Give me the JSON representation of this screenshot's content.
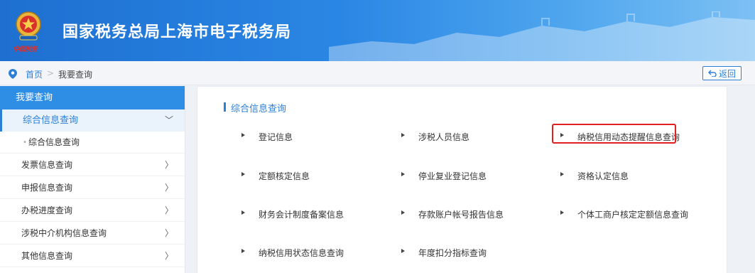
{
  "header": {
    "title": "国家税务总局上海市电子税务局",
    "emblem_icon": "tax-emblem-icon",
    "emblem_caption": "中国税务",
    "gradient_colors": [
      "#1e6fd0",
      "#7cc0f4"
    ]
  },
  "breadcrumb": {
    "home": "首页",
    "separator": ">",
    "current": "我要查询",
    "back_label": "返回",
    "pin_icon": "location-pin-icon",
    "back_icon": "return-arrow-icon"
  },
  "sidebar": {
    "heading": "我要查询",
    "active_item": {
      "label": "综合信息查询",
      "chevron": "﹀"
    },
    "sub_item": {
      "label": "综合信息查询"
    },
    "items": [
      {
        "label": "发票信息查询",
        "arrow": "〉"
      },
      {
        "label": "申报信息查询",
        "arrow": "〉"
      },
      {
        "label": "办税进度查询",
        "arrow": "〉"
      },
      {
        "label": "涉税中介机构信息查询",
        "arrow": "〉"
      },
      {
        "label": "其他信息查询",
        "arrow": "〉"
      }
    ]
  },
  "panel": {
    "title": "综合信息查询",
    "links": [
      [
        "登记信息",
        "涉税人员信息",
        "纳税信用动态提醒信息查询"
      ],
      [
        "定额核定信息",
        "停业复业登记信息",
        "资格认定信息"
      ],
      [
        "财务会计制度备案信息",
        "存款账户帐号报告信息",
        "个体工商户核定定额信息查询"
      ],
      [
        "纳税信用状态信息查询",
        "年度扣分指标查询"
      ]
    ],
    "highlight_color": "#e02020"
  },
  "accent_color": "#2b7fd6"
}
